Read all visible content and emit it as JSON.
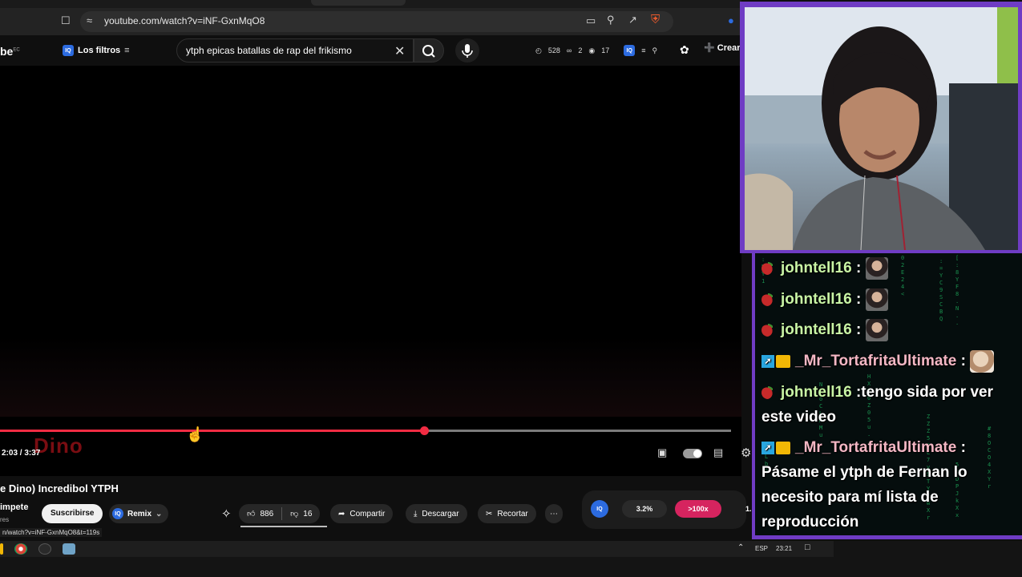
{
  "browser": {
    "url": "youtube.com/watch?v=iNF-GxnMqO8"
  },
  "youtube": {
    "logo_text": "be",
    "logo_sup": "EC",
    "filters_label": "Los filtros",
    "iq_label": "IQ",
    "search_value": "ytph epicas batallas de rap del frikismo",
    "stats": [
      "528",
      "2",
      "17"
    ],
    "create_label": "Crear"
  },
  "player": {
    "progress_fraction": 0.58,
    "overlay_text": "Dino",
    "time": "2:03 / 3:37"
  },
  "meta": {
    "title": "e Dino) Incredibol YTPH",
    "channel": "impete",
    "subs": "res",
    "subscribe_label": "Suscribirse",
    "remix_label": "Remix",
    "likes": "886",
    "dislikes": "16",
    "share_label": "Compartir",
    "download_label": "Descargar",
    "clip_label": "Recortar",
    "iq_stat_1": "3.2%",
    "iq_stat_2": ">100x",
    "iq_stat_3": "1.",
    "status_url": "n/watch?v=iNF-GxnMqO8&t=119s"
  },
  "taskbar": {
    "lang": "ESP",
    "clock": "23:21"
  },
  "chat": {
    "messages": [
      {
        "user": "johntell16",
        "sep": " :",
        "text": ""
      },
      {
        "user": "johntell16",
        "sep": " :",
        "text": ""
      },
      {
        "user": "johntell16",
        "sep": " :",
        "text": ""
      },
      {
        "user": "_Mr_TortafritaUltimate",
        "sep": " :",
        "text": ""
      },
      {
        "user": "johntell16",
        "sep": " :",
        "text": "tengo sida por ver"
      },
      {
        "user": "",
        "sep": "",
        "text": "este video"
      },
      {
        "user": "_Mr_TortafritaUltimate",
        "sep": " :",
        "text": ""
      },
      {
        "user": "",
        "sep": "",
        "text": "Pásame el ytph de Fernan lo"
      },
      {
        "user": "",
        "sep": "",
        "text": "necesito para mí lista de"
      },
      {
        "user": "",
        "sep": "",
        "text": "reproducción"
      }
    ]
  },
  "colors": {
    "progress": "#f22c43",
    "frame": "#6f3cc4",
    "chat_bg": "#050d0d"
  }
}
